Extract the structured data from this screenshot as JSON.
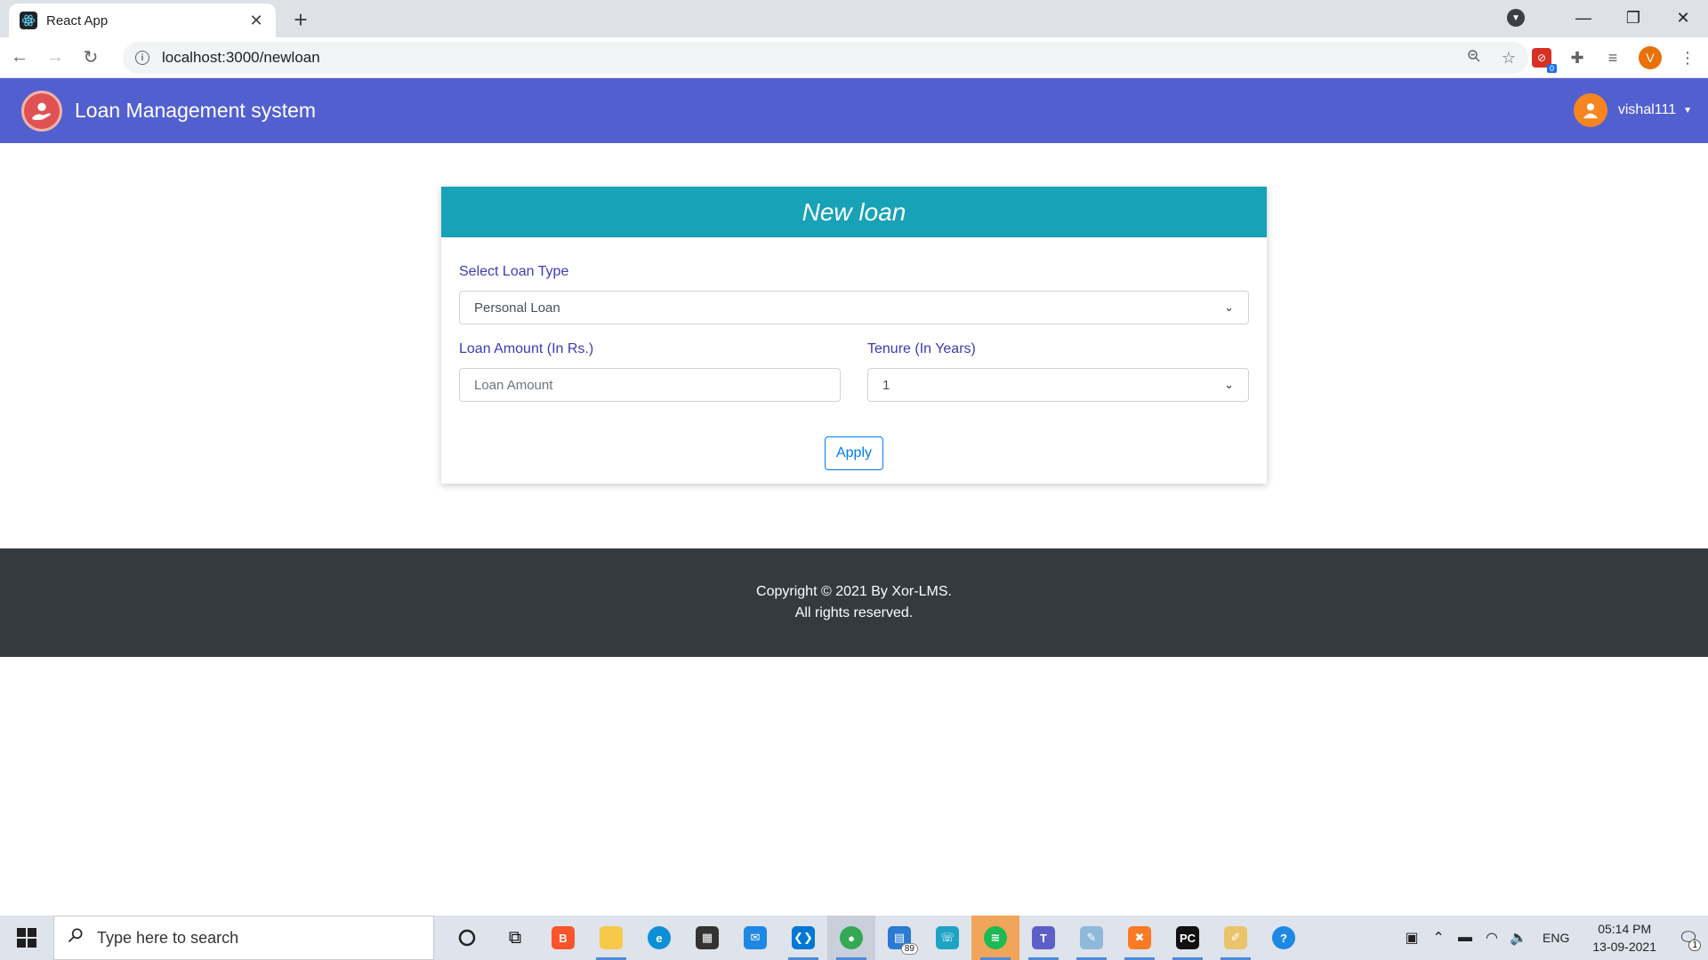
{
  "browser": {
    "tab_title": "React App",
    "url": "localhost:3000/newloan",
    "profile_initial": "V",
    "extension_badge": "0"
  },
  "navbar": {
    "brand_title": "Loan Management system",
    "username": "vishal111"
  },
  "form": {
    "title": "New loan",
    "loan_type_label": "Select Loan Type",
    "loan_type_value": "Personal Loan",
    "amount_label": "Loan Amount (In Rs.)",
    "amount_placeholder": "Loan Amount",
    "tenure_label": "Tenure (In Years)",
    "tenure_value": "1",
    "apply_label": "Apply"
  },
  "footer": {
    "line1": "Copyright © 2021 By Xor-LMS.",
    "line2": "All rights reserved."
  },
  "taskbar": {
    "search_placeholder": "Type here to search",
    "mail_badge": "89",
    "language": "ENG",
    "time": "05:14 PM",
    "date": "13-09-2021",
    "notification_count": "1"
  },
  "colors": {
    "navbar": "#5260cf",
    "card_header": "#17a2b8",
    "label": "#3b3bb8",
    "apply_border": "#007bff",
    "footer": "#343a40"
  }
}
